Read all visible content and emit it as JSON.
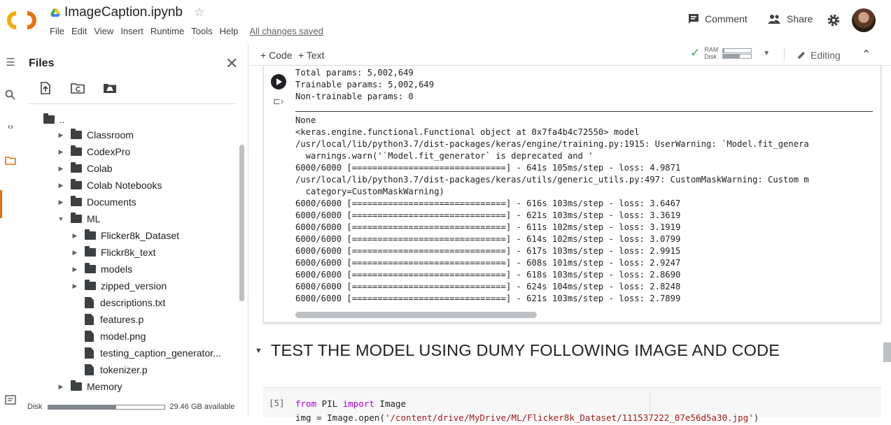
{
  "header": {
    "notebook_title": "ImageCaption.ipynb",
    "menu": [
      "File",
      "Edit",
      "View",
      "Insert",
      "Runtime",
      "Tools",
      "Help"
    ],
    "save_status": "All changes saved",
    "comment_label": "Comment",
    "share_label": "Share"
  },
  "rail": {
    "icons": [
      "menu-icon",
      "search-icon",
      "code-icon",
      "folder-icon"
    ],
    "bottom_icon": "terminal-icon"
  },
  "files": {
    "title": "Files",
    "parent_dir": "..",
    "tree": [
      {
        "name": "Classroom",
        "type": "folder",
        "depth": 1,
        "expanded": false
      },
      {
        "name": "CodexPro",
        "type": "folder",
        "depth": 1,
        "expanded": false
      },
      {
        "name": "Colab",
        "type": "folder",
        "depth": 1,
        "expanded": false
      },
      {
        "name": "Colab Notebooks",
        "type": "folder",
        "depth": 1,
        "expanded": false
      },
      {
        "name": "Documents",
        "type": "folder",
        "depth": 1,
        "expanded": false
      },
      {
        "name": "ML",
        "type": "folder",
        "depth": 1,
        "expanded": true
      },
      {
        "name": "Flicker8k_Dataset",
        "type": "folder",
        "depth": 2,
        "expanded": false
      },
      {
        "name": "Flickr8k_text",
        "type": "folder",
        "depth": 2,
        "expanded": false
      },
      {
        "name": "models",
        "type": "folder",
        "depth": 2,
        "expanded": false
      },
      {
        "name": "zipped_version",
        "type": "folder",
        "depth": 2,
        "expanded": false
      },
      {
        "name": "descriptions.txt",
        "type": "file",
        "depth": 2
      },
      {
        "name": "features.p",
        "type": "file",
        "depth": 2
      },
      {
        "name": "model.png",
        "type": "file",
        "depth": 2
      },
      {
        "name": "testing_caption_generator...",
        "type": "file",
        "depth": 2
      },
      {
        "name": "tokenizer.p",
        "type": "file",
        "depth": 2
      },
      {
        "name": "Memory",
        "type": "folder",
        "depth": 1,
        "expanded": false
      }
    ],
    "disk_label": "Disk",
    "disk_available": "29.46 GB available",
    "disk_used_fraction": 0.58
  },
  "toolbar": {
    "add_code": "+ Code",
    "add_text": "+ Text",
    "ram_label": "RAM",
    "disk_label": "Disk",
    "ram_fraction": 0.05,
    "disk_fraction": 0.6,
    "editing_label": "Editing"
  },
  "output": {
    "lines": [
      "Total params: 5,002,649",
      "Trainable params: 5,002,649",
      "Non-trainable params: 0",
      "",
      "None",
      "<keras.engine.functional.Functional object at 0x7fa4b4c72550> model",
      "/usr/local/lib/python3.7/dist-packages/keras/engine/training.py:1915: UserWarning: `Model.fit_genera",
      "  warnings.warn('`Model.fit_generator` is deprecated and '",
      "6000/6000 [==============================] - 641s 105ms/step - loss: 4.9871",
      "/usr/local/lib/python3.7/dist-packages/keras/utils/generic_utils.py:497: CustomMaskWarning: Custom m",
      "  category=CustomMaskWarning)",
      "6000/6000 [==============================] - 616s 103ms/step - loss: 3.6467",
      "6000/6000 [==============================] - 621s 103ms/step - loss: 3.3619",
      "6000/6000 [==============================] - 611s 102ms/step - loss: 3.1919",
      "6000/6000 [==============================] - 614s 102ms/step - loss: 3.0799",
      "6000/6000 [==============================] - 617s 103ms/step - loss: 2.9915",
      "6000/6000 [==============================] - 608s 101ms/step - loss: 2.9247",
      "6000/6000 [==============================] - 618s 103ms/step - loss: 2.8690",
      "6000/6000 [==============================] - 624s 104ms/step - loss: 2.8248",
      "6000/6000 [==============================] - 621s 103ms/step - loss: 2.7899"
    ]
  },
  "section": {
    "title": "TEST THE MODEL USING DUMY FOLLOWING IMAGE AND CODE"
  },
  "code_cell": {
    "exec_count": "[5]",
    "line1_kw1": "from",
    "line1_mod": " PIL ",
    "line1_kw2": "import",
    "line1_name": " Image",
    "line2_pre": "img = Image.open(",
    "line2_str": "'/content/drive/MyDrive/ML/Flicker8k_Dataset/111537222_07e56d5a30.jpg'",
    "line2_post": ")"
  }
}
